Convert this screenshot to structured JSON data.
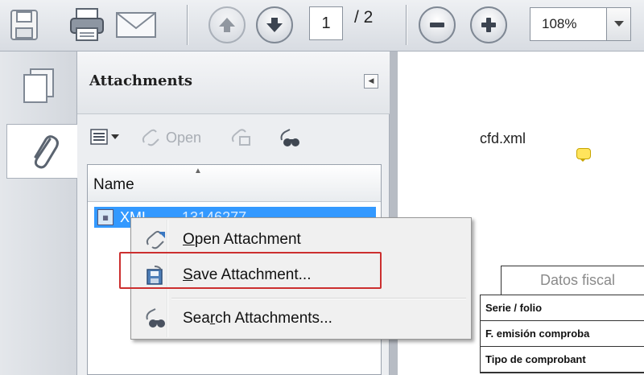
{
  "toolbar": {
    "page_current": "1",
    "page_total": "/ 2",
    "zoom": "108%",
    "icons": [
      "save-icon",
      "print-icon",
      "email-icon",
      "page-up-icon",
      "page-down-icon",
      "zoom-out-icon",
      "zoom-in-icon",
      "dropdown-arrow-icon"
    ]
  },
  "rail": {
    "items": [
      "pages-icon",
      "attachments-paperclip-icon"
    ]
  },
  "panel": {
    "title": "Attachments",
    "tools": {
      "open_label": "Open"
    },
    "list": {
      "column_name": "Name",
      "rows": [
        {
          "name": "XML",
          "extra": "13146277",
          "selected": true
        }
      ]
    }
  },
  "context_menu": {
    "items": [
      {
        "prefix": "",
        "mnemonic": "O",
        "suffix": "pen Attachment",
        "icon": "open-attachment-icon"
      },
      {
        "prefix": "",
        "mnemonic": "S",
        "suffix": "ave Attachment...",
        "icon": "save-attachment-icon",
        "highlighted": true
      },
      {
        "prefix": "Sea",
        "mnemonic": "r",
        "suffix": "ch Attachments...",
        "icon": "search-attachments-icon"
      }
    ]
  },
  "document": {
    "file_label": "cfd.xml",
    "fiscal_title": "Datos fiscal",
    "rows": [
      "Serie / folio",
      "F. emisión comproba",
      "Tipo de comprobant"
    ]
  },
  "colors": {
    "selection": "#3399ff",
    "highlight_border": "#cc2f2f"
  }
}
